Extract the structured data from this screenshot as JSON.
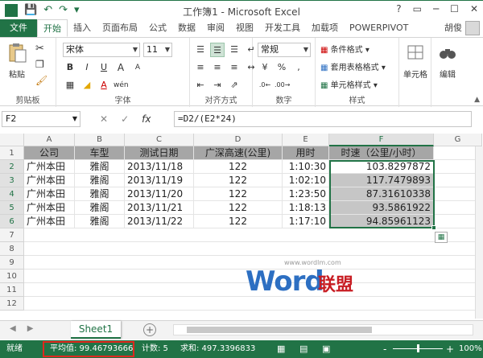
{
  "titlebar": {
    "title": "工作簿1 - Microsoft Excel",
    "logo": "X",
    "qat_icons": [
      "save-icon",
      "undo-icon",
      "redo-icon",
      "customize-icon"
    ],
    "window_controls": [
      "?",
      "▭",
      "─",
      "☐",
      "✕"
    ]
  },
  "tabs": [
    "文件",
    "开始",
    "插入",
    "页面布局",
    "公式",
    "数据",
    "审阅",
    "视图",
    "开发工具",
    "加载项",
    "POWERPIVOT"
  ],
  "active_tab": "开始",
  "user": "胡俊",
  "ribbon": {
    "clipboard": {
      "paste": "粘贴",
      "label": "剪贴板"
    },
    "font": {
      "name": "宋体",
      "size": "11",
      "label": "字体",
      "bold": "B",
      "italic": "I",
      "underline": "U",
      "grow": "A",
      "shrink": "A",
      "font_color": "A",
      "phonetic": "wén"
    },
    "alignment": {
      "label": "对齐方式"
    },
    "number": {
      "format": "常规",
      "label": "数字",
      "percent": "%",
      "comma": ",",
      "currency": "¥"
    },
    "styles": {
      "cond": "条件格式",
      "table": "套用表格格式",
      "cell": "单元格样式",
      "label": "样式"
    },
    "cells": {
      "label": "单元格"
    },
    "editing": {
      "label": "编辑"
    }
  },
  "formula_bar": {
    "name_box": "F2",
    "cancel": "✕",
    "enter": "✓",
    "fx": "fx",
    "formula": "=D2/(E2*24)"
  },
  "columns": [
    "A",
    "B",
    "C",
    "D",
    "E",
    "F",
    "G"
  ],
  "table": {
    "headers": [
      "公司",
      "车型",
      "测试日期",
      "广深高速(公里)",
      "用时",
      "时速（公里/小时）"
    ],
    "rows": [
      [
        "广州本田",
        "雅阁",
        "2013/11/18",
        "122",
        "1:10:30",
        "103.8297872"
      ],
      [
        "广州本田",
        "雅阁",
        "2013/11/19",
        "122",
        "1:02:10",
        "117.7479893"
      ],
      [
        "广州本田",
        "雅阁",
        "2013/11/20",
        "122",
        "1:23:50",
        "87.31610338"
      ],
      [
        "广州本田",
        "雅阁",
        "2013/11/21",
        "122",
        "1:18:13",
        "93.5861922"
      ],
      [
        "广州本田",
        "雅阁",
        "2013/11/22",
        "122",
        "1:17:10",
        "94.85961123"
      ]
    ],
    "row_numbers": [
      "1",
      "2",
      "3",
      "4",
      "5",
      "6",
      "7",
      "8",
      "9",
      "10",
      "11",
      "12",
      "13"
    ]
  },
  "watermark": {
    "url": "www.wordlm.com",
    "word": "Word",
    "cn": "联盟"
  },
  "sheets": {
    "active": "Sheet1",
    "add": "+"
  },
  "status": {
    "ready": "就绪",
    "average": "平均值: 99.46793666",
    "count": "计数: 5",
    "sum": "求和: 497.3396833",
    "zoom": "100%",
    "zoom_minus": "-",
    "zoom_plus": "+"
  },
  "colors": {
    "excel_green": "#217346",
    "header_gray": "#a6a6a6",
    "highlight_red": "#e0281e"
  }
}
